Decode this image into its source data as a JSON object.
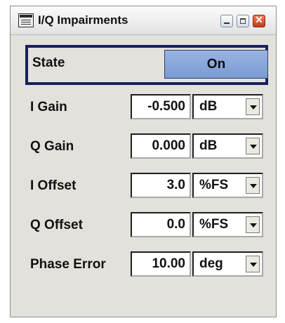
{
  "window": {
    "title": "I/Q Impairments"
  },
  "state": {
    "label": "State",
    "value": "On"
  },
  "rows": [
    {
      "label": "I Gain",
      "value": "-0.500",
      "unit": "dB"
    },
    {
      "label": "Q Gain",
      "value": "0.000",
      "unit": "dB"
    },
    {
      "label": "I Offset",
      "value": "3.0",
      "unit": "%FS"
    },
    {
      "label": "Q Offset",
      "value": "0.0",
      "unit": "%FS"
    },
    {
      "label": "Phase Error",
      "value": "10.00",
      "unit": "deg"
    }
  ]
}
